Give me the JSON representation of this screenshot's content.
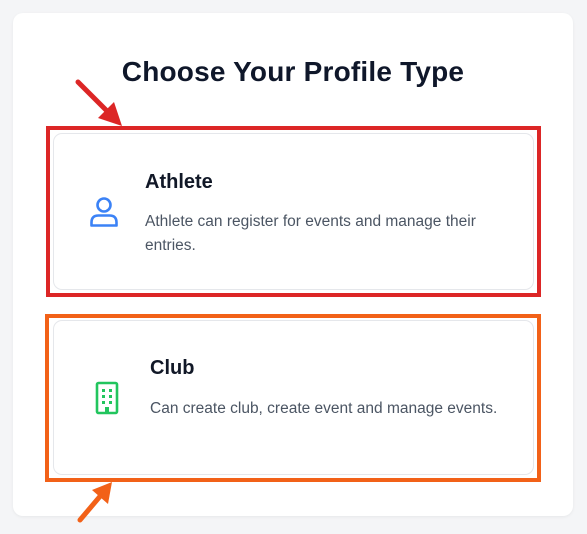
{
  "page": {
    "title": "Choose Your Profile Type"
  },
  "options": [
    {
      "title": "Athlete",
      "description": "Athlete can register for events and manage their entries.",
      "icon": "user-icon",
      "icon_color": "#3b82f6"
    },
    {
      "title": "Club",
      "description": "Can create club, create event and manage events.",
      "icon": "building-icon",
      "icon_color": "#22c55e"
    }
  ],
  "annotations": {
    "athlete_highlight_color": "#dc2626",
    "club_highlight_color": "#f26118",
    "athlete_arrow": "arrow-pointing-down-right",
    "club_arrow": "arrow-pointing-up-right"
  }
}
